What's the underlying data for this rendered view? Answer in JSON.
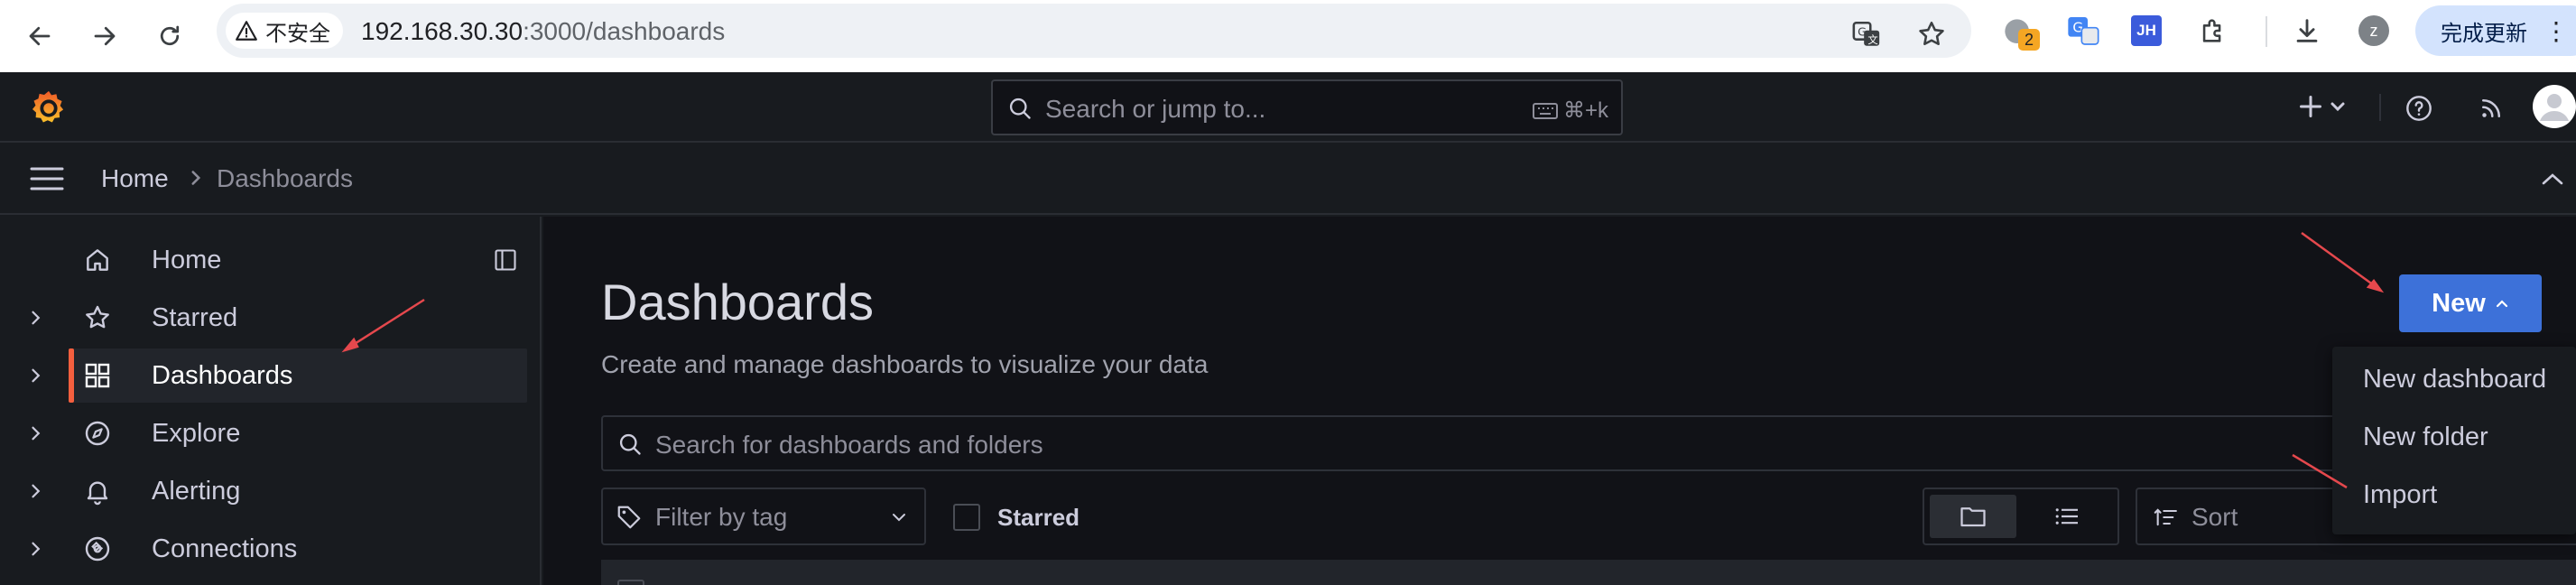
{
  "browser": {
    "security_label": "不安全",
    "url_host": "192.168.30.30",
    "url_rest": ":3000/dashboards",
    "badge_count": "2",
    "ext_jh_label": "JH",
    "profile_initial": "z",
    "update_label": "完成更新"
  },
  "topbar": {
    "search_placeholder": "Search or jump to...",
    "shortcut": "⌘+k"
  },
  "breadcrumb": {
    "home": "Home",
    "current": "Dashboards"
  },
  "sidebar": {
    "items": [
      {
        "label": "Home",
        "icon": "home-icon"
      },
      {
        "label": "Starred",
        "icon": "star-icon"
      },
      {
        "label": "Dashboards",
        "icon": "apps-icon"
      },
      {
        "label": "Explore",
        "icon": "compass-icon"
      },
      {
        "label": "Alerting",
        "icon": "bell-icon"
      },
      {
        "label": "Connections",
        "icon": "plug-icon"
      }
    ]
  },
  "main": {
    "title": "Dashboards",
    "subtitle": "Create and manage dashboards to visualize your data",
    "new_button": "New",
    "search_placeholder": "Search for dashboards and folders",
    "tag_filter_placeholder": "Filter by tag",
    "starred_label": "Starred",
    "sort_label": "Sort"
  },
  "new_menu": {
    "items": [
      "New dashboard",
      "New folder",
      "Import"
    ]
  },
  "colors": {
    "accent_primary": "#3d71d9",
    "active_bar": "#f55f3e",
    "annotation": "#e5484d"
  }
}
